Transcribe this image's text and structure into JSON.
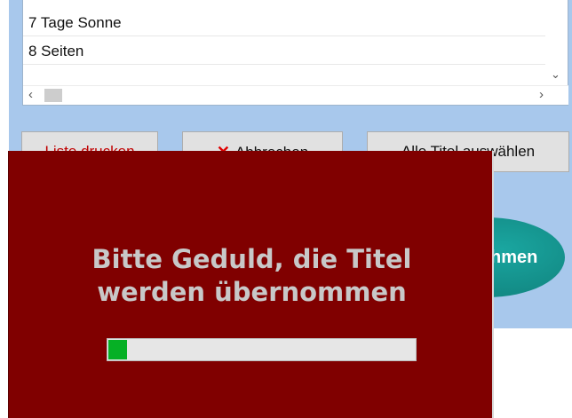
{
  "list": {
    "items": [
      {
        "label": "7 Tage Sonne"
      },
      {
        "label": "8 Seiten"
      }
    ]
  },
  "scrollbar": {
    "left_arrow": "‹",
    "right_arrow": "›",
    "down_arrow": "⌄"
  },
  "buttons": {
    "print_label": "Liste drucken",
    "cancel_icon": "✕",
    "cancel_label": "Abbrechen",
    "select_all_label": "Alle Titel auswählen",
    "accept_label": "hmen"
  },
  "dialog": {
    "message_line1": "Bitte Geduld, die Titel",
    "message_line2": "werden übernommen",
    "progress_fraction": 0.06
  },
  "colors": {
    "panel": "#a8c8ec",
    "dialog": "#800000",
    "progress_fill": "#06b025",
    "accept_button": "#1aa6a0"
  }
}
